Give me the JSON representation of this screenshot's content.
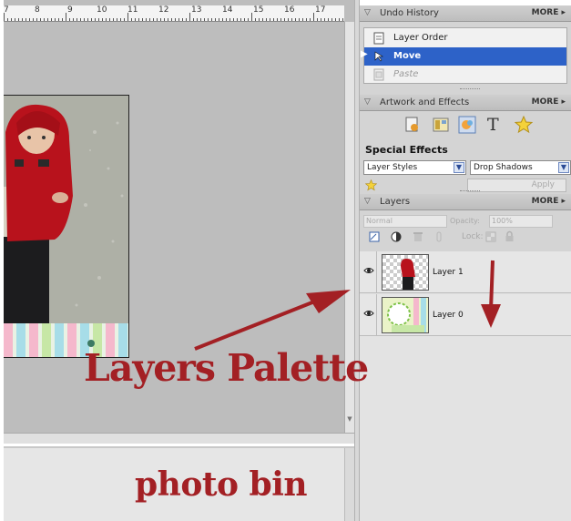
{
  "ruler": {
    "numbers": [
      "7",
      "8",
      "9",
      "10",
      "11",
      "12",
      "13",
      "14",
      "15",
      "16",
      "17"
    ]
  },
  "annotations": {
    "callout": "Layers Palette",
    "bin_label": "photo bin",
    "color": "#a32024"
  },
  "undo_history": {
    "title": "Undo History",
    "more": "MORE ▸",
    "items": [
      {
        "label": "Layer Order",
        "state": "normal"
      },
      {
        "label": "Move",
        "state": "selected"
      },
      {
        "label": "Paste",
        "state": "dimmed"
      }
    ]
  },
  "artwork": {
    "title": "Artwork and Effects",
    "more": "MORE ▸",
    "icons": [
      "apply-artwork-icon",
      "themes-icon",
      "special-effects-icon",
      "text-icon",
      "favorites-star-icon"
    ],
    "text_glyph": "T",
    "section_title": "Special Effects",
    "style_select": "Layer Styles",
    "type_select": "Drop Shadows",
    "apply_label": "Apply"
  },
  "layers": {
    "title": "Layers",
    "more": "MORE ▸",
    "blend_mode": "Normal",
    "opacity_label": "Opacity:",
    "opacity_value": "100%",
    "lock_label": "Lock:",
    "items": [
      {
        "name": "Layer 1",
        "visible": true
      },
      {
        "name": "Layer 0",
        "visible": true
      }
    ]
  },
  "colors": {
    "selection": "#2d62c8",
    "annotation": "#a32024",
    "panel": "#d4d4d4"
  }
}
